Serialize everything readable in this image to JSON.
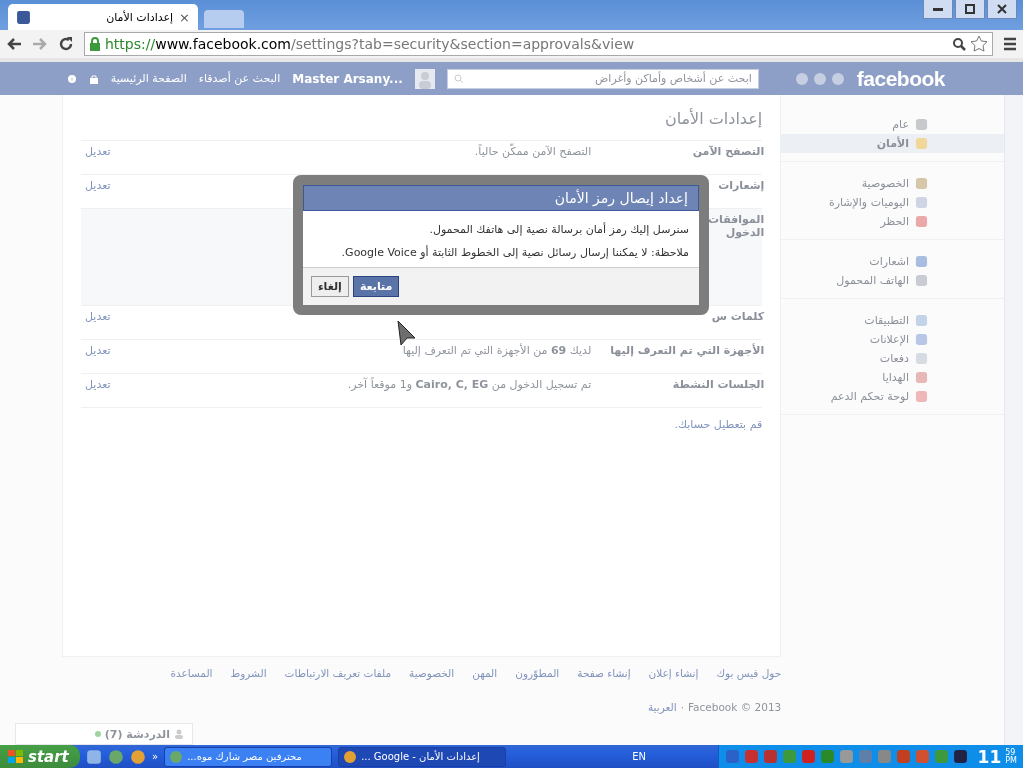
{
  "browser": {
    "tab_title": "إعدادات الأمان",
    "tab_close": "×",
    "url_scheme": "https://",
    "url_host": "www.facebook.com",
    "url_path": "/settings?tab=security&section=approvals&view"
  },
  "topbar": {
    "logo": "facebook",
    "search_placeholder": "ابحث عن أشخاص وأماكن وأغراض",
    "user": "Master Arsany...",
    "links": [
      "البحث عن أصدقاء",
      "الصفحة الرئيسية"
    ]
  },
  "settings": {
    "title": "إعدادات الأمان",
    "rows": [
      {
        "label": [
          "التصفح الآمن"
        ],
        "value": "التصفح الآمن ممكّن حالياً.",
        "edit": "تعديل"
      },
      {
        "label": [
          "إشعارات"
        ],
        "value": "",
        "edit": "تعديل"
      },
      {
        "label": [
          "الموافقات",
          "الدخول"
        ],
        "value": "",
        "edit": "",
        "expanded": true
      },
      {
        "label": [
          "كلمات س"
        ],
        "value": "",
        "edit": "تعديل"
      },
      {
        "label": [
          "الأجهزة التي تم التعرف إليها"
        ],
        "value": "لديك **69** من الأجهزة التي تم التعرف إليها",
        "edit": "تعديل"
      },
      {
        "label": [
          "الجلسات النشطة"
        ],
        "value": "تم تسجيل الدخول من **Cairo, C, EG** و1 موقعاً آخر.",
        "edit": "تعديل"
      }
    ],
    "deactivate": "قم بتعطيل حسابك."
  },
  "sidebar": {
    "groups": [
      [
        {
          "label": "عام",
          "selected": false
        },
        {
          "label": "الأمان",
          "selected": true
        }
      ],
      [
        {
          "label": "الخصوصية",
          "selected": false
        },
        {
          "label": "اليوميات والإشارة",
          "selected": false
        },
        {
          "label": "الحظر",
          "selected": false
        }
      ],
      [
        {
          "label": "اشعارات",
          "selected": false
        },
        {
          "label": "الهاتف المحمول",
          "selected": false
        }
      ],
      [
        {
          "label": "التطبيقات",
          "selected": false
        },
        {
          "label": "الإعلانات",
          "selected": false
        },
        {
          "label": "دفعات",
          "selected": false
        },
        {
          "label": "الهدايا",
          "selected": false
        },
        {
          "label": "لوحة تحكم الدعم",
          "selected": false
        }
      ]
    ]
  },
  "dialog": {
    "title": "إعداد إيصال رمز الأمان",
    "lines": [
      "سنرسل إليك رمز أمان برسالة نصية إلى هاتفك المحمول.",
      "ملاحظة: لا يمكننا إرسال رسائل نصية إلى الخطوط الثابتة أو Google Voice."
    ],
    "buttons": [
      {
        "label": "متابعة",
        "kind": "primary"
      },
      {
        "label": "إلغاء",
        "kind": "secondary"
      }
    ]
  },
  "footer": {
    "links": [
      "حول فيس بوك",
      "إنشاء إعلان",
      "إنشاء صفحة",
      "المطوّرون",
      "المهن",
      "الخصوصية",
      "ملفات تعريف الارتباطات",
      "الشروط",
      "المساعدة"
    ],
    "copyright": "Facebook © 2013",
    "separator": "·",
    "language": "العربية"
  },
  "chat": {
    "label": "الدردشة (7)"
  },
  "taskbar": {
    "start": "start",
    "more": "»",
    "tasks": [
      {
        "label": "إعدادات الأمان - Google ...",
        "selected": true
      },
      {
        "label": "محترفين مصر شارك موه...",
        "selected": false
      }
    ],
    "language": "EN",
    "clock_hour": "11",
    "clock_minute": "59",
    "clock_period": "PM"
  }
}
